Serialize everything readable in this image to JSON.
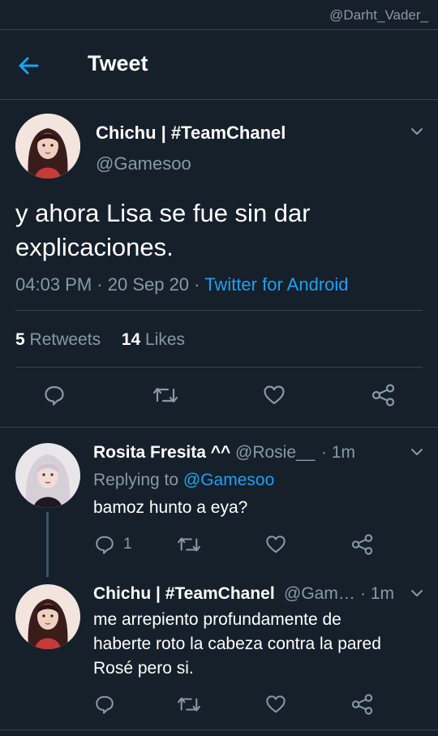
{
  "watermark": "@Darht_Vader_",
  "header": {
    "title": "Tweet",
    "back_icon": "arrow-left-icon"
  },
  "main_tweet": {
    "author_name": "Chichu | #TeamChanel",
    "author_handle": "@Gamesoo",
    "text_line1": "y ahora Lisa se fue sin dar",
    "text_line2": "explicaciones.",
    "time": "04:03 PM",
    "sep1": " · ",
    "date": "20 Sep 20",
    "sep2": " · ",
    "source": "Twitter for Android",
    "retweets_count": "5",
    "retweets_label": "Retweets",
    "likes_count": "14",
    "likes_label": "Likes"
  },
  "replies": [
    {
      "author_name": "Rosita Fresita ^^",
      "author_handle": "@Rosie__",
      "time": "· 1m",
      "replying_prefix": "Replying to",
      "replying_handle": "@Gamesoo",
      "text": "bamoz hunto a eya?",
      "reply_count": "1"
    },
    {
      "author_name": "Chichu | #TeamChanel",
      "author_handle": "@Gam…",
      "time": "· 1m",
      "text_line1": "me arrepiento profundamente de",
      "text_line2": "haberte roto la cabeza contra la pared",
      "text_line3": "Rosé pero si."
    }
  ],
  "colors": {
    "background": "#15202b",
    "divider": "#38444d",
    "muted": "#8899a6",
    "accent": "#1da1f2"
  }
}
